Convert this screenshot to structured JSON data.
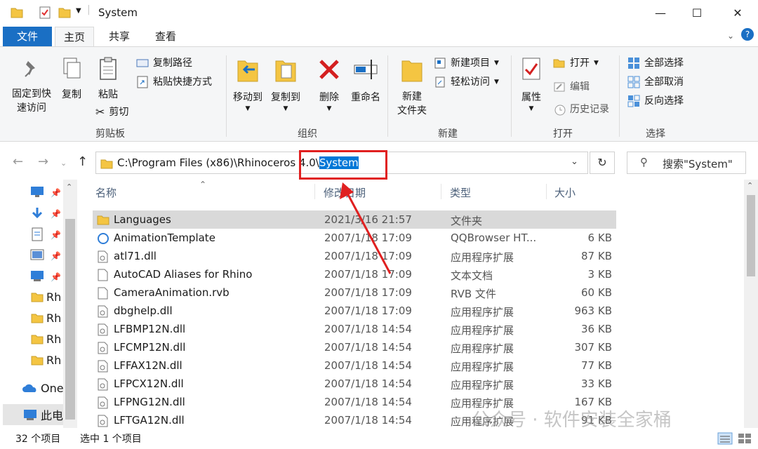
{
  "window": {
    "title": "System",
    "controls": {
      "minimize": "—",
      "maximize": "☐",
      "close": "✕"
    }
  },
  "tabs": [
    "文件",
    "主页",
    "共享",
    "查看"
  ],
  "ribbon": {
    "clipboard": {
      "pin": "固定到快\n速访问",
      "copy": "复制",
      "paste": "粘贴",
      "copy_path": "复制路径",
      "paste_shortcut": "粘贴快捷方式",
      "cut": "剪切",
      "group": "剪贴板"
    },
    "organize": {
      "move_to": "移动到",
      "copy_to": "复制到",
      "delete": "删除",
      "rename": "重命名",
      "group": "组织"
    },
    "new": {
      "new_folder": "新建\n文件夹",
      "new_item": "新建项目",
      "easy_access": "轻松访问",
      "group": "新建"
    },
    "open": {
      "properties": "属性",
      "open": "打开",
      "edit": "编辑",
      "history": "历史记录",
      "group": "打开"
    },
    "select": {
      "select_all": "全部选择",
      "select_none": "全部取消",
      "invert": "反向选择",
      "group": "选择"
    }
  },
  "address": {
    "path_prefix": "C:\\Program Files (x86)\\Rhinoceros 4.0\\",
    "path_selected": "System",
    "refresh": "↻",
    "search_placeholder": "搜索\"System\""
  },
  "nav": {
    "items": [
      {
        "label": "Rh"
      },
      {
        "label": "Rh"
      },
      {
        "label": "Rh"
      },
      {
        "label": "Rh"
      },
      {
        "label": "One"
      },
      {
        "label": "此电"
      }
    ]
  },
  "columns": {
    "name": "名称",
    "date": "修改日期",
    "type": "类型",
    "size": "大小"
  },
  "files": [
    {
      "name": "Languages",
      "date": "2021/3/16 21:57",
      "type": "文件夹",
      "size": ""
    },
    {
      "name": "AnimationTemplate",
      "date": "2007/1/18 17:09",
      "type": "QQBrowser HT...",
      "size": "6 KB"
    },
    {
      "name": "atl71.dll",
      "date": "2007/1/18 17:09",
      "type": "应用程序扩展",
      "size": "87 KB"
    },
    {
      "name": "AutoCAD Aliases for Rhino",
      "date": "2007/1/18 17:09",
      "type": "文本文档",
      "size": "3 KB"
    },
    {
      "name": "CameraAnimation.rvb",
      "date": "2007/1/18 17:09",
      "type": "RVB 文件",
      "size": "60 KB"
    },
    {
      "name": "dbghelp.dll",
      "date": "2007/1/18 17:09",
      "type": "应用程序扩展",
      "size": "963 KB"
    },
    {
      "name": "LFBMP12N.dll",
      "date": "2007/1/18 14:54",
      "type": "应用程序扩展",
      "size": "36 KB"
    },
    {
      "name": "LFCMP12N.dll",
      "date": "2007/1/18 14:54",
      "type": "应用程序扩展",
      "size": "307 KB"
    },
    {
      "name": "LFFAX12N.dll",
      "date": "2007/1/18 14:54",
      "type": "应用程序扩展",
      "size": "77 KB"
    },
    {
      "name": "LFPCX12N.dll",
      "date": "2007/1/18 14:54",
      "type": "应用程序扩展",
      "size": "33 KB"
    },
    {
      "name": "LFPNG12N.dll",
      "date": "2007/1/18 14:54",
      "type": "应用程序扩展",
      "size": "167 KB"
    },
    {
      "name": "LFTGA12N.dll",
      "date": "2007/1/18 14:54",
      "type": "应用程序扩展",
      "size": "91 KB"
    }
  ],
  "status": {
    "count": "32 个项目",
    "selected": "选中 1 个项目"
  },
  "watermark": "公众号 · 软件安装全家桶",
  "colors": {
    "accent": "#1a6fc4",
    "highlight": "#e02020",
    "selection": "#0078d7"
  }
}
